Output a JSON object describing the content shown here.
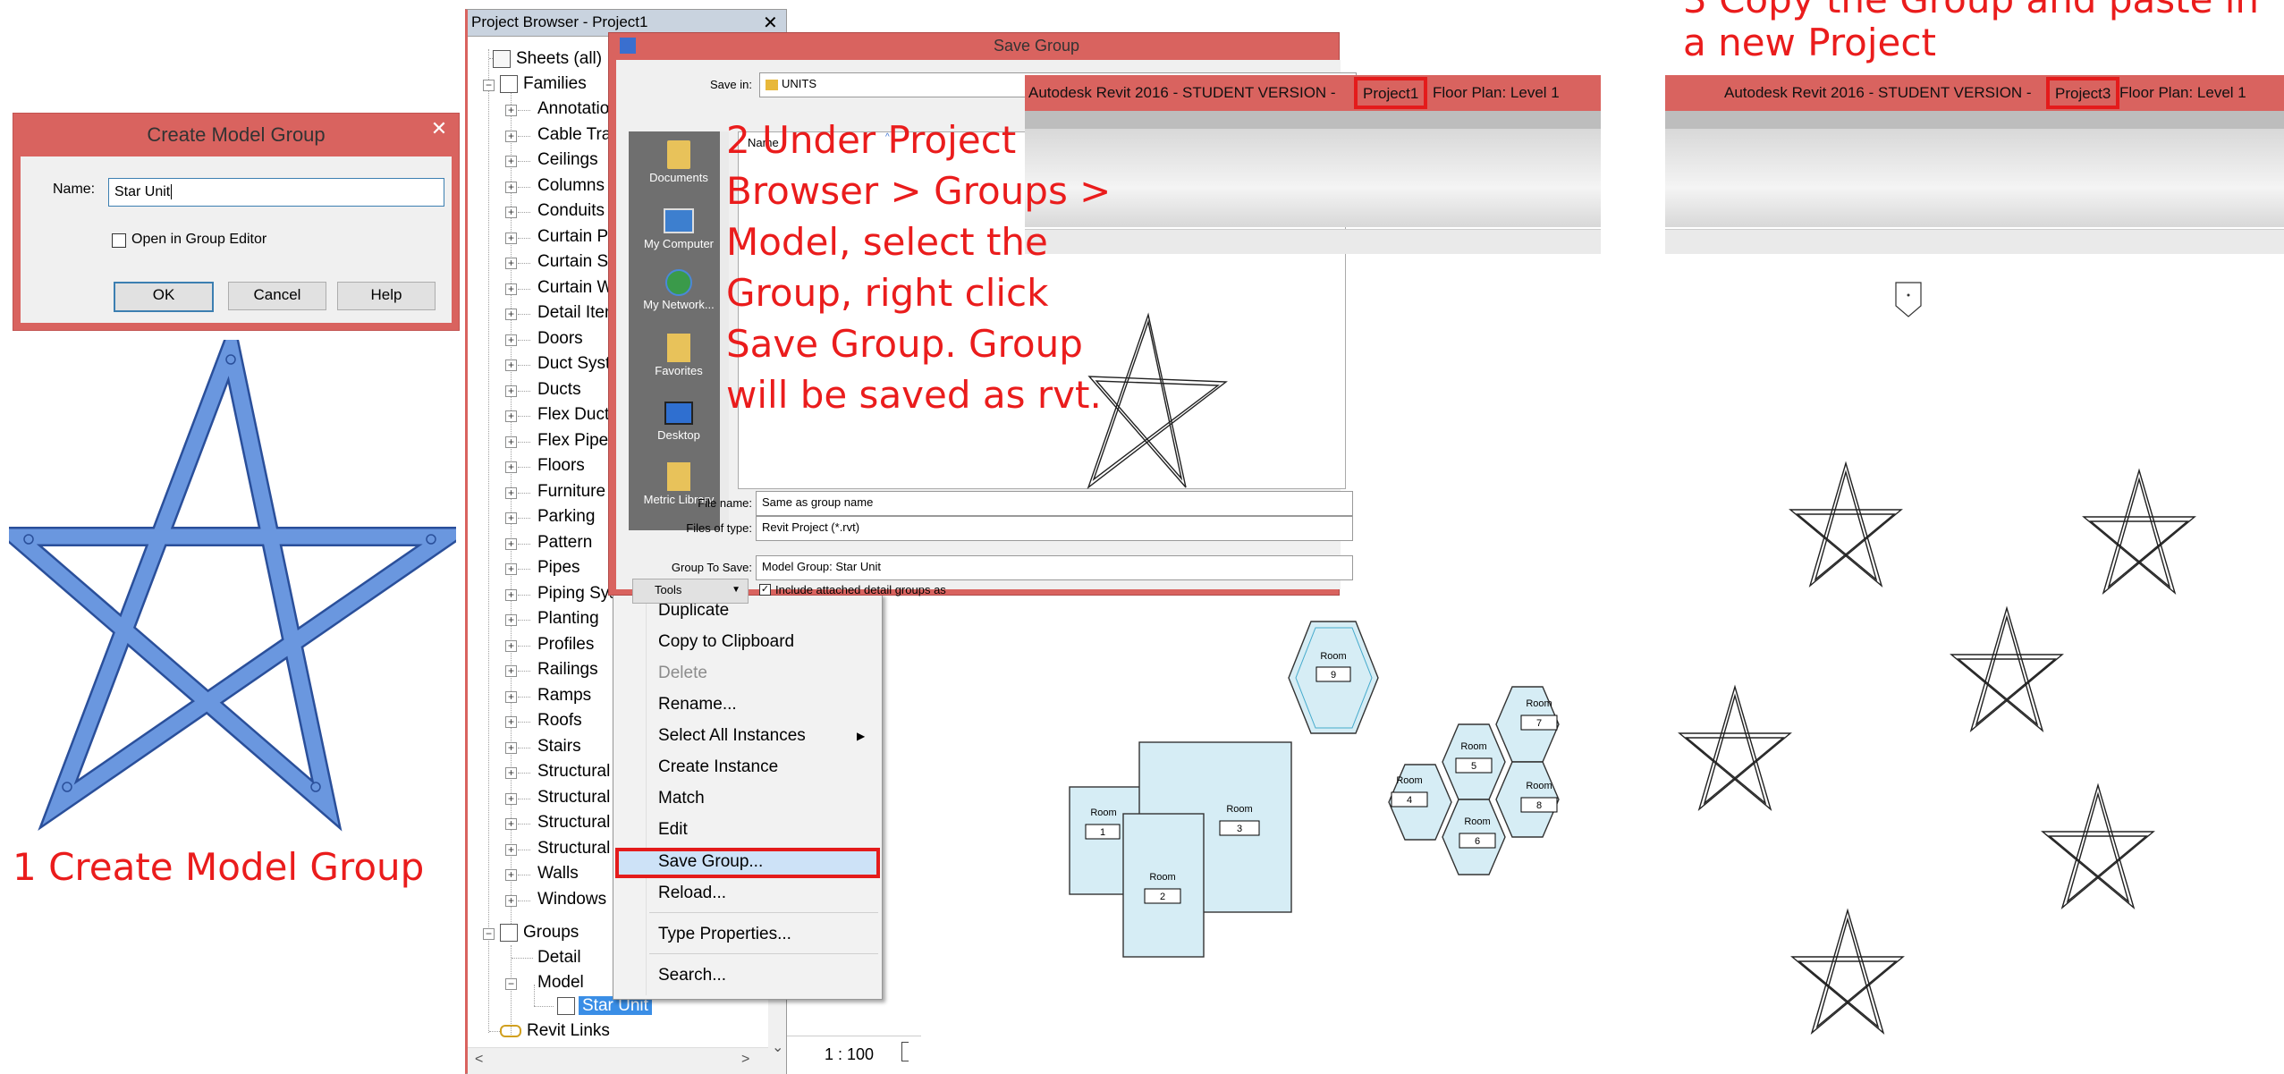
{
  "colors": {
    "annotation": "#ea1c1c",
    "titlebar": "#d9635f",
    "selection": "#cde8ff",
    "star_blue": "#4a7ed6",
    "room_fill": "#d6edf5"
  },
  "create_dialog": {
    "title": "Create Model Group",
    "name_label": "Name:",
    "name_value": "Star Unit",
    "open_in_editor": "Open in Group Editor",
    "ok": "OK",
    "cancel": "Cancel",
    "help": "Help",
    "close_icon": "close-icon"
  },
  "annotations": {
    "step1": "1 Create Model Group",
    "step2": [
      "2 Under Project",
      "Browser > Groups >",
      "Model, select the",
      "Group, right click",
      "Save Group.  Group",
      "will be saved as rvt."
    ],
    "step3": [
      "3 Copy the Group and paste in",
      "a new Project"
    ]
  },
  "project_browser": {
    "title": "Project Browser - Project1",
    "close": "✕",
    "sheets": "Sheets (all)",
    "families_label": "Families",
    "families": [
      "Annotatio",
      "Cable Tray",
      "Ceilings",
      "Columns",
      "Conduits",
      "Curtain Pa",
      "Curtain Sy",
      "Curtain W",
      "Detail Iten",
      "Doors",
      "Duct Syste",
      "Ducts",
      "Flex Ducts",
      "Flex Pipes",
      "Floors",
      "Furniture",
      "Parking",
      "Pattern",
      "Pipes",
      "Piping Sys",
      "Planting",
      "Profiles",
      "Railings",
      "Ramps",
      "Roofs",
      "Stairs",
      "Structural",
      "Structural",
      "Structural",
      "Structural",
      "Walls",
      "Windows"
    ],
    "groups": "Groups",
    "detail": "Detail",
    "model": "Model",
    "star_unit": "Star Unit",
    "revit_links": "Revit Links",
    "scale": "1 : 100"
  },
  "context_menu": {
    "items": [
      "Duplicate",
      "Copy to Clipboard",
      "Delete",
      "Rename...",
      "Select All Instances",
      "Create Instance",
      "Match",
      "Edit",
      "Save Group...",
      "Reload...",
      "Type Properties...",
      "Search..."
    ],
    "disabled": "Delete",
    "highlighted": "Save Group..."
  },
  "save_group": {
    "title": "Save Group",
    "save_in_label": "Save in:",
    "save_in_value": "UNITS",
    "name_col": "Name",
    "places": [
      "Documents",
      "My Computer",
      "My Network...",
      "Favorites",
      "Desktop",
      "Metric Library"
    ],
    "file_name_label": "File name:",
    "file_name_value": "Same as group name",
    "files_type_label": "Files of type:",
    "files_type_value": "Revit Project  (*.rvt)",
    "group_to_save_label": "Group To Save:",
    "group_to_save_value": "Model Group: Star Unit",
    "include_label": "Include attached detail groups as",
    "tools": "Tools"
  },
  "revit1": {
    "app": "Autodesk Revit 2016 - STUDENT VERSION -",
    "project": "Project1",
    "view": "Floor Plan: Level 1"
  },
  "revit3": {
    "app": "Autodesk Revit 2016 - STUDENT VERSION -",
    "project": "Project3",
    "view": "Floor Plan: Level 1"
  },
  "rooms": [
    {
      "label": "Room",
      "number": "1"
    },
    {
      "label": "Room",
      "number": "2"
    },
    {
      "label": "Room",
      "number": "3"
    },
    {
      "label": "Room",
      "number": "4"
    },
    {
      "label": "Room",
      "number": "5"
    },
    {
      "label": "Room",
      "number": "6"
    },
    {
      "label": "Room",
      "number": "7"
    },
    {
      "label": "Room",
      "number": "8"
    },
    {
      "label": "Room",
      "number": "9"
    }
  ]
}
